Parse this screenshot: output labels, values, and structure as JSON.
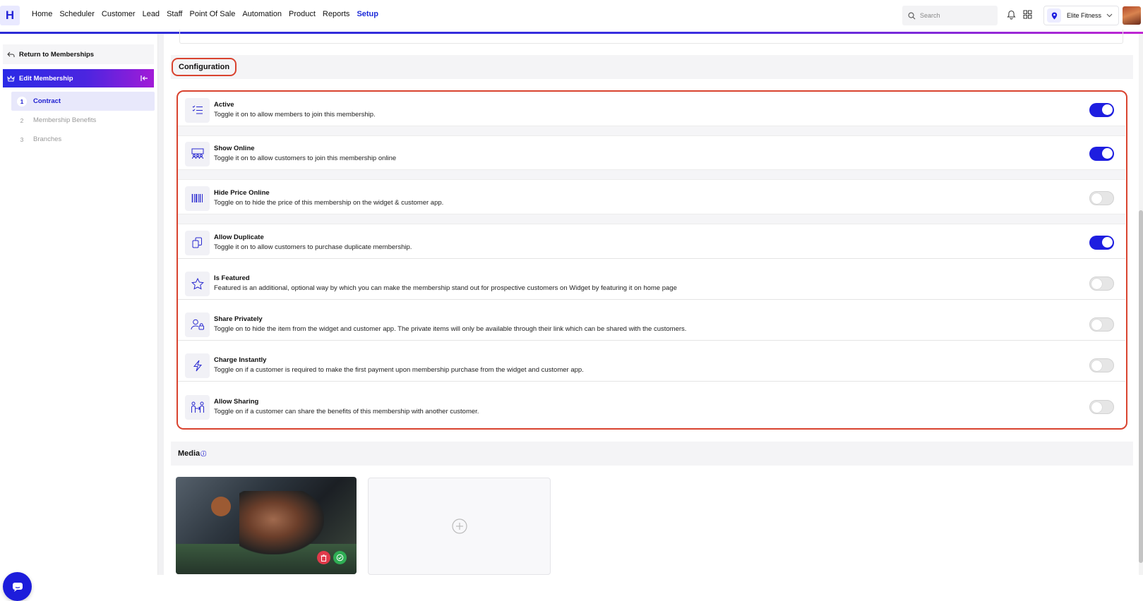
{
  "brand": {
    "logo_letter": "H",
    "accent": "#1e1ee0",
    "highlight": "#d9432f"
  },
  "nav": {
    "items": [
      "Home",
      "Scheduler",
      "Customer",
      "Lead",
      "Staff",
      "Point Of Sale",
      "Automation",
      "Product",
      "Reports",
      "Setup"
    ],
    "active": "Setup"
  },
  "header": {
    "search_placeholder": "Search",
    "location": "Elite Fitness"
  },
  "sidebar": {
    "return_label": "Return to Memberships",
    "edit_label": "Edit Membership",
    "steps": [
      {
        "num": "1",
        "label": "Contract",
        "active": true
      },
      {
        "num": "2",
        "label": "Membership Benefits",
        "active": false
      },
      {
        "num": "3",
        "label": "Branches",
        "active": false
      }
    ]
  },
  "configuration": {
    "heading": "Configuration",
    "items": [
      {
        "icon": "checklist-icon",
        "title": "Active",
        "desc": "Toggle it on to allow members to join this membership.",
        "on": true
      },
      {
        "icon": "group-screen-icon",
        "title": "Show Online",
        "desc": "Toggle it on to allow customers to join this membership online",
        "on": true
      },
      {
        "icon": "barcode-icon",
        "title": "Hide Price Online",
        "desc": "Toggle on to hide the price of this membership on the widget & customer app.",
        "on": false
      },
      {
        "icon": "duplicate-icon",
        "title": "Allow Duplicate",
        "desc": "Toggle it on to allow customers to purchase duplicate membership.",
        "on": true
      },
      {
        "icon": "star-icon",
        "title": "Is Featured",
        "desc": "Featured is an additional, optional way by which you can make the membership stand out for prospective customers on Widget by featuring it on home page",
        "on": false
      },
      {
        "icon": "user-lock-icon",
        "title": "Share Privately",
        "desc": "Toggle on to hide the item from the widget and customer app. The private items will only be available through their link which can be shared with the customers.",
        "on": false
      },
      {
        "icon": "lightning-icon",
        "title": "Charge Instantly",
        "desc": "Toggle on if a customer is required to make the first payment upon membership purchase from the widget and customer app.",
        "on": false
      },
      {
        "icon": "people-share-icon",
        "title": "Allow Sharing",
        "desc": "Toggle on if a customer can share the benefits of this membership with another customer.",
        "on": false
      }
    ]
  },
  "media": {
    "heading": "Media",
    "info_mark": "i"
  }
}
